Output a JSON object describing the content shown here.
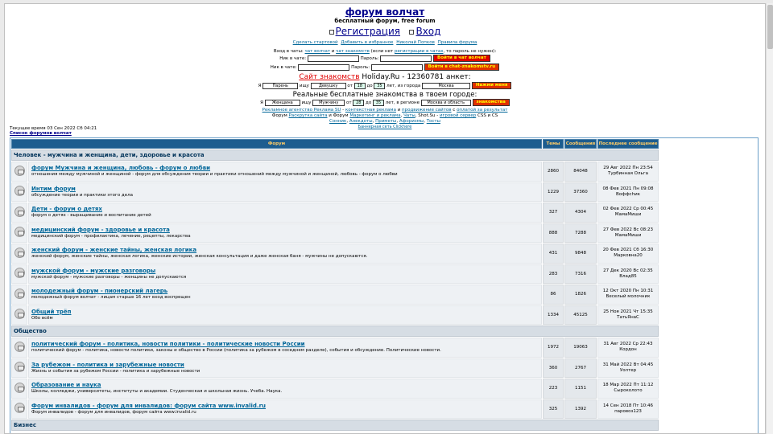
{
  "header": {
    "title": "форум волчат",
    "subtitle": "бесплатный форум, free forum",
    "register": "Регистрация",
    "login": "Вход",
    "links": [
      "Сделать стартовой",
      "Добавить в избранное",
      "Николай Попков",
      "Правила форума"
    ]
  },
  "chat": {
    "line_prefix": "Вход в чаты: ",
    "link1": "чат волчат",
    "and": " и ",
    "link2": "чат знакомств",
    "mid": " (если нет ",
    "link3": "регистрации в чатах",
    "suffix": ", то пароль не нужен):",
    "nick_label": "Ник в чате:",
    "pass_label": "Пароль:",
    "btn1": "Войти в чат волчат",
    "btn2": "Войти в chat-znakomstv.ru"
  },
  "dating": {
    "site_link": "Сайт знакомств",
    "holiday": " Holiday.Ru - 12360781 анкет:",
    "ya": "Я",
    "who": "Парень",
    "ishu": "ищу",
    "whom": "Девушку",
    "from": "от",
    "age_from": "18",
    "to": "до",
    "age_to": "35",
    "city_label": "лет, из города",
    "city": "Москва",
    "btn": "Нажми меня"
  },
  "real": {
    "title": "Реальные бесплатные знакомства в твоем городе:",
    "ya": "Я",
    "who": "Женщина",
    "ishu": "ищу",
    "whom": "Мужчину",
    "from": "от",
    "age_from": "28",
    "to": "до",
    "age_to": "35",
    "region_label": "лет, в регионе",
    "region": "Москва и область",
    "btn": "знакомства"
  },
  "ads": {
    "l1a": "Рекламное агентство Реклама SU",
    "l1b": " - ",
    "l1c": "контекстная реклама",
    "l1d": " и ",
    "l1e": "продвижение сайтов",
    "l1f": " с ",
    "l1g": "оплатой за результат",
    "l2a": "Форум ",
    "l2b": "Раскрутка сайта",
    "l2c": " и Форум ",
    "l2d": "Маркетинг и реклама",
    "l2e": ", ",
    "l2f": "Чаты",
    "l2g": ", Shot.Su - ",
    "l2h": "игровой сервер",
    "l2i": " CSS и CS",
    "l3a": "Сонник",
    "l3b": "Анекдоты",
    "l3c": "Приметы",
    "l3d": "Афоризмы",
    "l3e": "Тосты",
    "l4": "Баннерная сеть Clickhere"
  },
  "meta": {
    "time": "Текущее время 03 Сен 2022 Сб 04:21",
    "forum_list": "Список форумов волчат"
  },
  "table": {
    "headers": [
      "Форум",
      "Темы",
      "Сообщения",
      "Последнее сообщение"
    ],
    "categories": [
      {
        "name": "Человек - мужчина и женщина, дети, здоровье и красота",
        "forums": [
          {
            "title": "форум Мужчина и женщина, любовь - форум о любви",
            "desc": "отношения между мужчиной и женщиной - форум для обсуждения теории и практики отношений между мужчиной и женщиной, любовь - форум о любви",
            "topics": "2860",
            "posts": "84048",
            "last_date": "29 Авг 2022 Пн 23:54",
            "last_user": "Турбинная Ольга"
          },
          {
            "title": "Интим форум",
            "desc": "обсуждение теории и практики этого дела",
            "topics": "1229",
            "posts": "37360",
            "last_date": "08 Фев 2021 Пн 09:08",
            "last_user": "Boффchик"
          },
          {
            "title": "Дети - форум о детях",
            "desc": "форум о детях - выращивание и воспитание детей",
            "topics": "327",
            "posts": "4304",
            "last_date": "02 Фев 2022 Ср 00:45",
            "last_user": "МамаМиши"
          },
          {
            "title": "медицинский форум - здоровье и красота",
            "desc": "медицинский форум - профилактика, лечение, рецепты, лекарства",
            "topics": "888",
            "posts": "7288",
            "last_date": "27 Фев 2022 Вс 08:23",
            "last_user": "МамаМиши"
          },
          {
            "title": "женский форум - женские тайны, женская логика",
            "desc": "женский форум, женские тайны, женская логика, женские истории, женская консультация и даже женская баня - мужчины не допускаются.",
            "topics": "431",
            "posts": "9848",
            "last_date": "20 Фев 2021 Сб 16:30",
            "last_user": "Марковна20"
          },
          {
            "title": "мужской форум - мужские разговоры",
            "desc": "мужской форум - мужские разговоры - женщины не допускаются",
            "topics": "283",
            "posts": "7316",
            "last_date": "27 Дек 2020 Вс 02:35",
            "last_user": "Влад85"
          },
          {
            "title": "молодежный форум - пионерский лагерь",
            "desc": "молодежный форум волчат - лицам старше 16 лет вход воспрещен",
            "topics": "86",
            "posts": "1826",
            "last_date": "12 Окт 2020 Пн 10:31",
            "last_user": "Веселый молочник"
          },
          {
            "title": "Общий трёп",
            "desc": "Обо всём",
            "topics": "1334",
            "posts": "45125",
            "last_date": "25 Ноя 2021 Чт 15:35",
            "last_user": "ТатьЯнаС"
          }
        ]
      },
      {
        "name": "Общество",
        "forums": [
          {
            "title": "политический форум - политика, новости политики - политические новости России",
            "desc": "политический форум - политика, новости политики, законы и общество в России (политика за рубежом в соседнем разделе), события и обсуждение. Политические новости.",
            "topics": "1972",
            "posts": "19063",
            "last_date": "31 Авг 2022 Ср 22:43",
            "last_user": "Кордон"
          },
          {
            "title": "За рубежом - политика и зарубежные новости",
            "desc": "Жизнь и события за рубежом России - политика и зарубежные новости",
            "topics": "360",
            "posts": "2767",
            "last_date": "31 Май 2022 Вт 04:45",
            "last_user": "Уолтер"
          },
          {
            "title": "Образование и наука",
            "desc": "Школы, колледжи, университеты, институты и академии. Студенческая и школьная жизнь. Учеба. Наука.",
            "topics": "223",
            "posts": "1151",
            "last_date": "18 Мар 2022 Пт 11:12",
            "last_user": "Сыроколото"
          },
          {
            "title": "Форум инвалидов - форум для инвалидов: форум сайта www.invalid.ru",
            "desc": "Форум инвалидов - форум для инвалидов, форум сайта www.invalid.ru",
            "topics": "325",
            "posts": "1392",
            "last_date": "14 Сен 2018 Пт 10:46",
            "last_user": "паровоз123"
          }
        ]
      },
      {
        "name": "Бизнес",
        "forums": []
      }
    ]
  }
}
